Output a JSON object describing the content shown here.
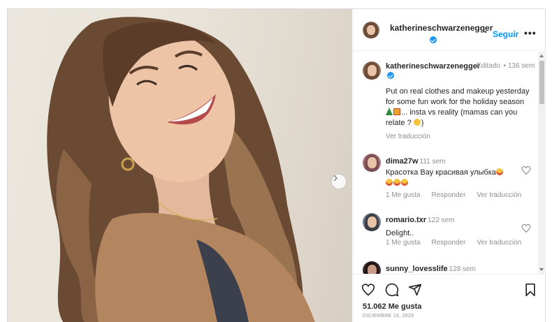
{
  "post": {
    "username": "katherineschwarzenegger",
    "follow_label": "Seguir",
    "dot": "•",
    "more_label": "•••",
    "caption": {
      "edited": "Editado",
      "age": "136 sem",
      "text": "Put on real clothes and makeup yesterday for some fun work for the holiday season",
      "text_tail": "... insta vs reality (mamas can you relate ?",
      "text_end": ")",
      "translate": "Ver traducción"
    },
    "comments": [
      {
        "username": "dima27w",
        "age": "111 sem",
        "text": "Красотка Вау красивая улыбка",
        "likes": "1 Me gusta",
        "reply": "Responder",
        "translate": "Ver traducción"
      },
      {
        "username": "romario.txr",
        "age": "122 sem",
        "text": "Delight..",
        "likes": "1 Me gusta",
        "reply": "Responder",
        "translate": "Ver traducción"
      },
      {
        "username": "sunny_lovesslife",
        "age": "128 sem"
      }
    ],
    "likes_count": "51.062 Me gusta",
    "date": "DICIEMBRE 16, 2020",
    "icons": {
      "like": "heart-icon",
      "comment": "comment-icon",
      "share": "share-icon",
      "save": "bookmark-icon",
      "next": "chevron-right-icon"
    },
    "colors": {
      "accent": "#0095f6",
      "verified": "#1c96f0",
      "muted": "#8e8e8e"
    }
  }
}
